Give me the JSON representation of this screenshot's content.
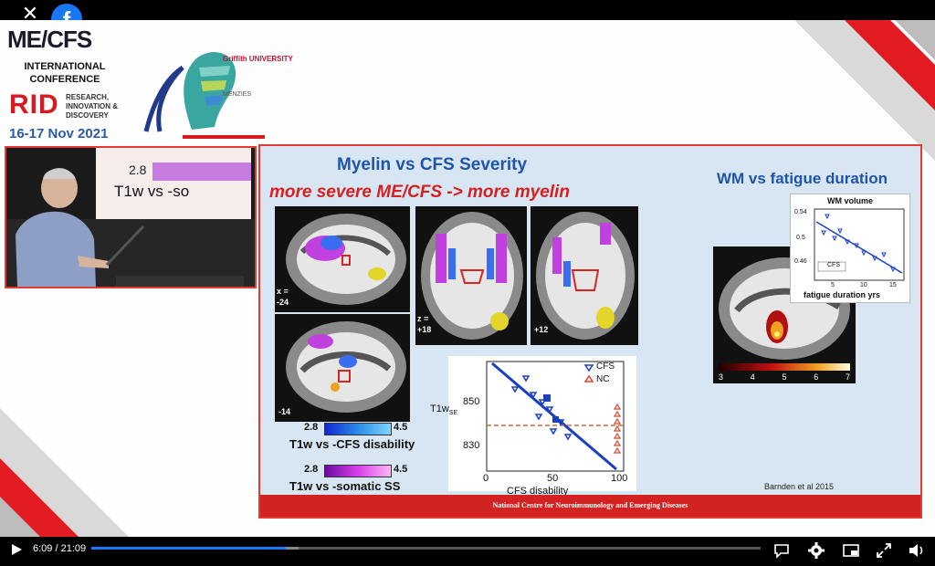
{
  "overlay": {
    "close_icon": "close-icon",
    "facebook_icon": "facebook-icon",
    "facebook_glyph": "f"
  },
  "branding": {
    "title": "ME/CFS",
    "conference": "INTERNATIONAL CONFERENCE",
    "rid": "RID",
    "rid_sub": "RESEARCH, INNOVATION & DISCOVERY",
    "dates": "16-17 Nov 2021",
    "griffith": "Griffith UNIVERSITY",
    "menzies": "MENZIES"
  },
  "pip": {
    "screen_value": "2.8",
    "screen_text": "T1w  vs  -so"
  },
  "slide": {
    "title": "Myelin  vs  CFS Severity",
    "subtitle": "more severe ME/CFS  ->  more myelin",
    "wm_title": "WM vs fatigue duration",
    "brain_labels": {
      "x": "x =",
      "x_val": "-24",
      "z": "z =",
      "z_val": "+18",
      "axial2": "+12",
      "sag2": "-14"
    },
    "colorbar1": {
      "min": "2.8",
      "max": "4.5",
      "label": "T1w  vs  -CFS disability"
    },
    "colorbar2": {
      "min": "2.8",
      "max": "4.5",
      "label": "T1w  vs  -somatic SS"
    },
    "scatter_main": {
      "ylabel": "T1w",
      "ylabel_sub": "SE",
      "xlabel": "CFS disability",
      "yticks": [
        "850",
        "830"
      ],
      "xticks": [
        "0",
        "50",
        "100"
      ],
      "legend_cfs": "CFS",
      "legend_nc": "NC"
    },
    "scatter_wm": {
      "title": "WM volume",
      "xlabel": "fatigue duration yrs",
      "yticks": [
        "0.54",
        "0.5",
        "0.46"
      ],
      "xticks": [
        "5",
        "10",
        "15"
      ],
      "legend": "CFS"
    },
    "heat_scale": [
      "3",
      "4",
      "5",
      "6",
      "7"
    ],
    "cite": "Barnden et al 2015",
    "footer": "National Centre for Neuroimmunology and Emerging Diseases"
  },
  "player": {
    "time": "6:09 / 21:09",
    "progress": 0.29,
    "buffered": 0.31,
    "accent": "#1877f2",
    "icons": [
      "play-icon",
      "captions-icon",
      "settings-icon",
      "pip-icon",
      "fullscreen-icon",
      "volume-icon"
    ]
  }
}
